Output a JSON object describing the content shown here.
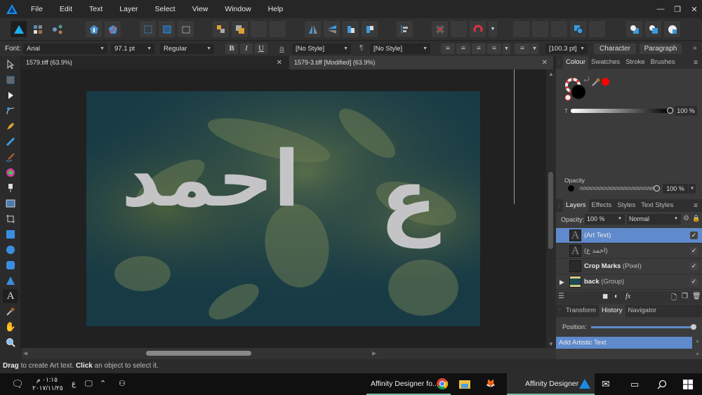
{
  "app": {
    "name": "Affinity Designer"
  },
  "menu": [
    "File",
    "Edit",
    "Text",
    "Layer",
    "Select",
    "View",
    "Window",
    "Help"
  ],
  "window_controls": {
    "minimize": "—",
    "restore": "❐",
    "close": "✕"
  },
  "context_toolbar": {
    "font_label": "Font:",
    "font_family": "Arial",
    "font_size": "97.1 pt",
    "font_style": "Regular",
    "bold": "B",
    "italic": "I",
    "underline": "U",
    "char_style": "[No Style]",
    "para_style": "[No Style]",
    "leading": "[100.3 pt]",
    "character_button": "Character",
    "paragraph_button": "Paragraph"
  },
  "document_tabs": [
    {
      "label": "1579.tiff (63.9%)",
      "active": false
    },
    {
      "label": "1579-3.tiff [Modified] (63.9%)",
      "active": true
    }
  ],
  "canvas": {
    "art_text_1": "احمد",
    "art_text_2": "ع",
    "text_color": "#c4c4c6",
    "background_color": "#173a45"
  },
  "colour_panel": {
    "tabs": [
      "Colour",
      "Swatches",
      "Stroke",
      "Brushes"
    ],
    "active_tab": "Colour",
    "tint_label": "T",
    "tint_value": "100 %",
    "tint_fraction": 1.0,
    "opacity_label": "Opacity",
    "opacity_value": "100 %",
    "opacity_fraction": 1.0,
    "fill_color": "#000000",
    "picked_color": "#ff0000"
  },
  "layers_panel": {
    "tabs": [
      "Layers",
      "Effects",
      "Styles",
      "Text Styles"
    ],
    "active_tab": "Layers",
    "opacity_label": "Opacity:",
    "opacity_value": "100 %",
    "blend_mode": "Normal",
    "layers": [
      {
        "name": "",
        "type": "(Art Text)",
        "thumb": "A",
        "selected": true,
        "visible": true
      },
      {
        "name": "",
        "type": "(احمد ع)",
        "thumb": "A",
        "selected": false,
        "visible": true
      },
      {
        "name": "Crop Marks",
        "type": "(Pixel)",
        "thumb": "",
        "selected": false,
        "visible": true
      },
      {
        "name": "back",
        "type": "(Group)",
        "thumb": "img",
        "selected": false,
        "visible": true,
        "expandable": true
      }
    ]
  },
  "history_panel": {
    "tabs": [
      "Transform",
      "History",
      "Navigator"
    ],
    "active_tab": "History",
    "position_label": "Position:",
    "position_fraction": 1.0,
    "items": [
      "Add Artistic Text"
    ]
  },
  "status_bar": {
    "bold1": "Drag",
    "text1": " to create Art text. ",
    "bold2": "Click",
    "text2": " an object to select it."
  },
  "taskbar": {
    "time": "٠١:١٥ م",
    "date": "٢٠١٧/١١/٢٥",
    "lang": "ع",
    "items": [
      {
        "label": "Affinity Designer fo...",
        "icon": "chrome-icon"
      },
      {
        "label": "",
        "icon": "folder-icon"
      },
      {
        "label": "",
        "icon": "gimp-icon"
      },
      {
        "label": "Affinity Designer",
        "icon": "affinity-designer-icon"
      }
    ]
  }
}
